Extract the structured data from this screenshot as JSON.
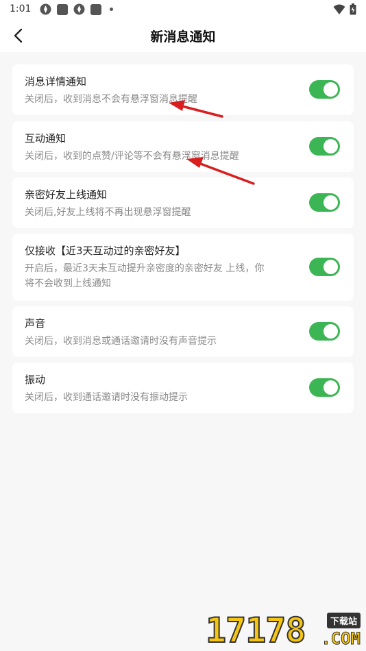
{
  "status_bar": {
    "time": "1:01"
  },
  "header": {
    "title": "新消息通知"
  },
  "settings": [
    {
      "title": "消息详情通知",
      "desc": "关闭后，收到消息不会有悬浮窗消息提醒",
      "enabled": true
    },
    {
      "title": "互动通知",
      "desc": "关闭后，收到的点赞/评论等不会有悬浮窗消息提醒",
      "enabled": true
    },
    {
      "title": "亲密好友上线通知",
      "desc": "关闭后,好友上线将不再出现悬浮窗提醒",
      "enabled": true
    },
    {
      "title": "仅接收【近3天互动过的亲密好友】",
      "desc_line1": "开启后，最近3天未互动提升亲密度的亲密好友 上线，你",
      "desc_line2": "将不会收到上线通知",
      "enabled": true
    },
    {
      "title": "声音",
      "desc": "关闭后，收到消息或通话邀请时没有声音提示",
      "enabled": true
    },
    {
      "title": "振动",
      "desc": "关闭后，收到通话邀请时没有振动提示",
      "enabled": true
    }
  ],
  "watermark": {
    "number": "17178",
    "tag": "下载站",
    "domain": ".COM"
  },
  "colors": {
    "toggle_on": "#3cb654",
    "annotation_arrow": "#d81e1e"
  }
}
